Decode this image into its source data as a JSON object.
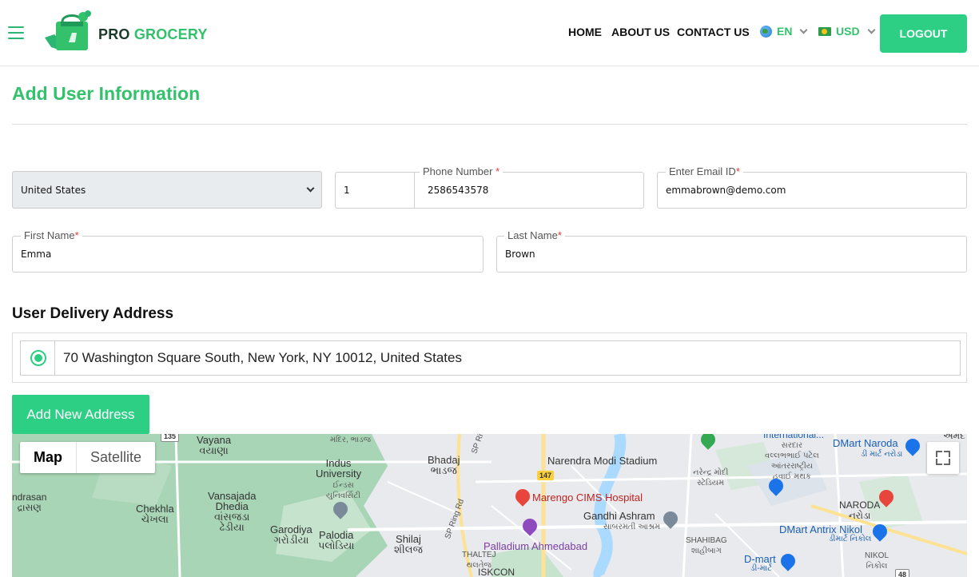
{
  "header": {
    "brand_pro": "PRO",
    "brand_grocery": "GROCERY",
    "nav": {
      "home": "HOME",
      "about": "ABOUT US",
      "contact": "CONTACT US"
    },
    "language": "EN",
    "currency": "USD",
    "logout_label": "LOGOUT"
  },
  "page": {
    "title": "Add User Information"
  },
  "form": {
    "country": "United States",
    "phone_code": "1",
    "phone_label": "Phone Number",
    "phone_value": "2586543578",
    "email_label": "Enter Email ID",
    "email_value": "emmabrown@demo.com",
    "first_name_label": "First Name",
    "first_name_value": "Emma",
    "last_name_label": "Last Name",
    "last_name_value": "Brown",
    "required_mark": "*"
  },
  "delivery": {
    "section_title": "User Delivery Address",
    "addresses": [
      {
        "text": "70 Washington Square South, New York, NY 10012, United States",
        "selected": true
      }
    ],
    "add_new_label": "Add New Address"
  },
  "map": {
    "map_label": "Map",
    "satellite_label": "Satellite",
    "places": {
      "vayana": "Vayana",
      "vayana_gu": "વયાણા",
      "indus": "Indus",
      "indus_univ": "University",
      "indus_gu": "ઈન્ડસ",
      "indus_gu2": "યુનિવર્સિટી",
      "bhadaj": "Bhadaj",
      "bhadaj_gu": "ભાડજ",
      "mandir_gu": "મંદિર, ભાડજ",
      "narendra": "Narendra Modi Stadium",
      "narendra_gu": "નરેન્દ્ર મોદી",
      "narendra_gu2": "સ્ટેડિયમ",
      "international": "International...",
      "sardar_gu": "સરદાર",
      "vallabh_gu": "વલ્લભભાઈ પટેલ",
      "antar_gu": "આંતરરાષ્ટ્રીય",
      "hawai_gu": "હવાઈ મથક",
      "dmart_naroda": "DMart Naroda",
      "dmart_naroda_gu": "ડી માર્ટ નરોડા",
      "naroda": "NARODA",
      "naroda_gu": "નરોડા",
      "vansajada": "Vansajada",
      "dhedia": "Dhedia",
      "vansajada_gu": "વાંસજડા",
      "dhedia_gu": "ઢેડીયા",
      "chekhla": "Chekhla",
      "chekhla_gu": "ચેખલા",
      "dhrasan": "ndrasan",
      "dhrasan_gu": "દ્રાસણ",
      "garodiya": "Garodiya",
      "garodiya_gu": "ગરોડીયા",
      "palodia": "Palodia",
      "palodia_gu": "પલોડિયા",
      "shilaj": "Shilaj",
      "shilaj_gu": "શીલજ",
      "thaltej": "THALTEJ",
      "thaltej_gu": "થલતેજ",
      "iskcon": "ISKCON",
      "marengo": "Marengo CIMS Hospital",
      "gandhi": "Gandhi Ashram",
      "gandhi_gu": "સાબરમતી આશ્રમ",
      "palladium": "Palladium Ahmedabad",
      "shahibag": "SHAHIBAG",
      "shahibag_gu": "શાહીબાગ",
      "dmart_nikol": "DMart Antrix Nikol",
      "dmart_nikol_gu": "ડીમાર્ટ નિકોલ",
      "dmart": "D-mart",
      "dmart_gu": "ડી-માર્ટ",
      "nikol": "NIKOL",
      "nikol_gu": "નિકોલ",
      "sp_ring": "SP Ring Rd",
      "sp_ring2": "SP Ri",
      "road_135": "135",
      "road_147": "147",
      "road_48": "48",
      "ahmeda": "અમદ"
    }
  }
}
